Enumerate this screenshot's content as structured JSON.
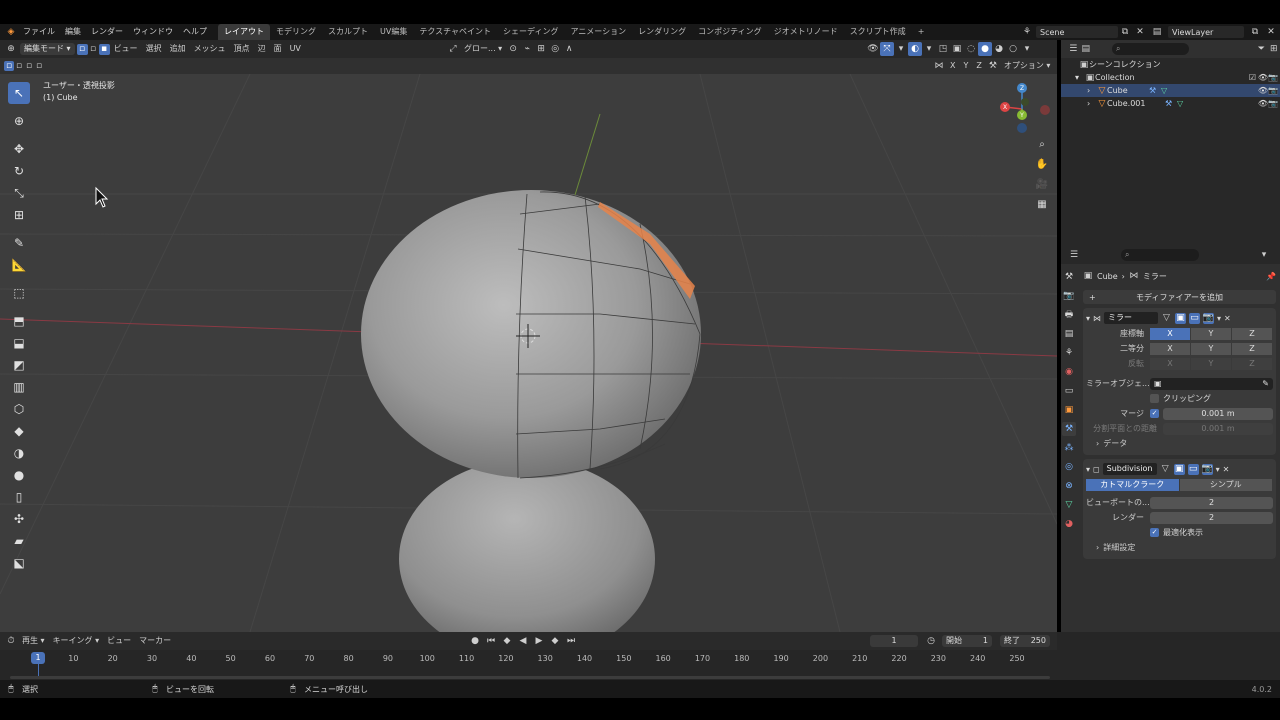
{
  "menu": [
    "ファイル",
    "編集",
    "レンダー",
    "ウィンドウ",
    "ヘルプ"
  ],
  "workspaces": [
    "レイアウト",
    "モデリング",
    "スカルプト",
    "UV編集",
    "テクスチャペイント",
    "シェーディング",
    "アニメーション",
    "レンダリング",
    "コンポジティング",
    "ジオメトリノード",
    "スクリプト作成"
  ],
  "scene": "Scene",
  "view_layer": "ViewLayer",
  "viewport_header": {
    "mode": "編集モード",
    "items": [
      "ビュー",
      "選択",
      "追加",
      "メッシュ",
      "頂点",
      "辺",
      "面",
      "UV"
    ],
    "orientation": "グロー..."
  },
  "viewport_header2": {
    "axes": [
      "X",
      "Y",
      "Z"
    ],
    "options": "オプション"
  },
  "viewport_info": {
    "line1": "ユーザー・透視投影",
    "line2": "(1) Cube"
  },
  "gizmo": {
    "x": "X",
    "y": "Y",
    "z": "Z"
  },
  "outliner": {
    "title": "シーンコレクション",
    "collection": "Collection",
    "objects": [
      "Cube",
      "Cube.001"
    ]
  },
  "properties": {
    "breadcrumb_object": "Cube",
    "breadcrumb_modifier": "ミラー",
    "add_modifier": "モディファイアーを追加",
    "mirror": {
      "name": "ミラー",
      "axis_label": "座標軸",
      "bisect_label": "二等分",
      "flip_label": "反転",
      "axes": [
        "X",
        "Y",
        "Z"
      ],
      "mirror_object_label": "ミラーオブジェ...",
      "clipping": "クリッピング",
      "merge_label": "マージ",
      "merge_value": "0.001 m",
      "bisect_distance_label": "分割平面との距離",
      "bisect_distance_value": "0.001 m",
      "data": "データ"
    },
    "subdivision": {
      "name": "Subdivision",
      "catmull": "カトマルクラーク",
      "simple": "シンプル",
      "viewport_label": "ビューポートの...",
      "viewport_value": "2",
      "render_label": "レンダー",
      "render_value": "2",
      "optimal": "最適化表示",
      "advanced": "詳細設定"
    }
  },
  "timeline": {
    "menu": [
      "再生",
      "キーイング",
      "ビュー",
      "マーカー"
    ],
    "current_frame": "1",
    "start_label": "開始",
    "start": "1",
    "end_label": "終了",
    "end": "250",
    "frames": [
      "1",
      "10",
      "20",
      "30",
      "40",
      "50",
      "60",
      "70",
      "80",
      "90",
      "100",
      "110",
      "120",
      "130",
      "140",
      "150",
      "160",
      "170",
      "180",
      "190",
      "200",
      "210",
      "220",
      "230",
      "240",
      "250"
    ]
  },
  "statusbar": {
    "select": "選択",
    "rotate": "ビューを回転",
    "menu": "メニュー呼び出し",
    "version": "4.0.2"
  },
  "colors": {
    "accent": "#4a72b8",
    "selection": "#e8844a",
    "bg": "#3d3d3d"
  }
}
